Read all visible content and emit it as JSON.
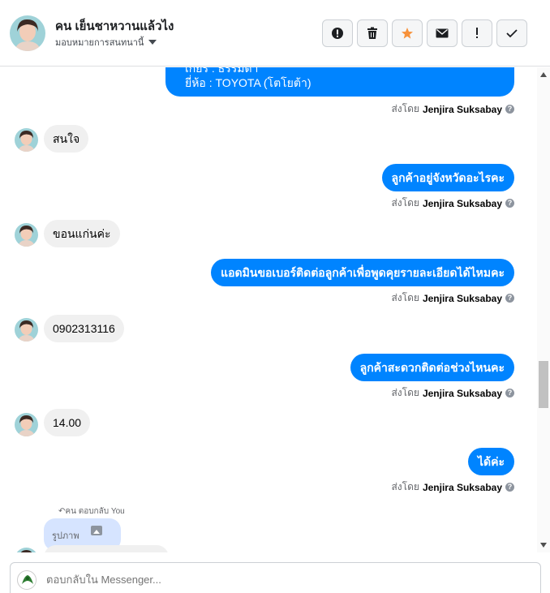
{
  "header": {
    "contact_name": "คน เย็นชาหวานแล้วไง",
    "assign_label": "มอบหมายการสนทนานี้"
  },
  "toolbar": {
    "icons": [
      "alert-circle-icon",
      "trash-icon",
      "star-icon",
      "envelope-icon",
      "exclamation-icon",
      "check-icon"
    ]
  },
  "messages": {
    "m0": {
      "line1": "เกียร์ : ธรรมดา",
      "line2": "ยี่ห้อ : TOYOTA (โตโยต้า)"
    },
    "sent_prefix": "ส่งโดย",
    "sender": "Jenjira Suksabay",
    "m1": "สนใจ",
    "m2": "ลูกค้าอยู่จังหวัดอะไรคะ",
    "m3": "ขอนแก่นค่ะ",
    "m4": "แอดมินขอเบอร์ติดต่อลูกค้าเพื่อพูดคุยรายละเอียดได้ไหมคะ",
    "m5": "0902313116",
    "m6": "ลูกค้าสะดวกติดต่อช่วงไหนคะ",
    "m7": "14.00",
    "m8": "ได้ค่ะ",
    "reply_meta": "คน ตอบกลับ You",
    "quoted_label": "รูปภาพ"
  },
  "composer": {
    "placeholder": "ตอบกลับใน Messenger..."
  },
  "colors": {
    "outgoing": "#0084ff",
    "incoming": "#f0f0f0",
    "star": "#f7923b"
  }
}
